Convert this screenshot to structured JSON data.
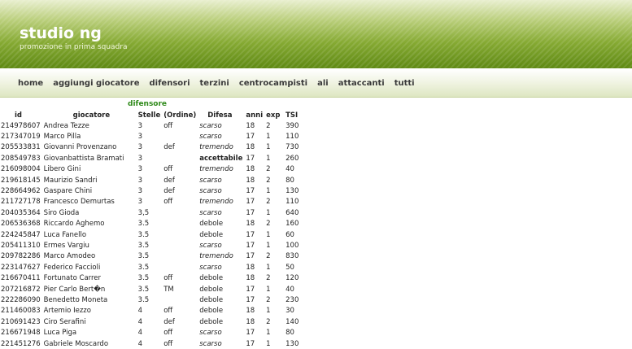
{
  "header": {
    "title": "studio ng",
    "subtitle": "promozione in prima squadra"
  },
  "nav": [
    "home",
    "aggiungi giocatore",
    "difensori",
    "terzini",
    "centrocampisti",
    "ali",
    "attaccanti",
    "tutti"
  ],
  "section_label": "difensore",
  "table": {
    "columns": [
      "id",
      "giocatore",
      "Stelle",
      "(Ordine)",
      "Difesa",
      "anni",
      "exp",
      "TSI"
    ],
    "rows": [
      [
        "214978607",
        "Andrea Tezze",
        "3",
        "off",
        "scarso",
        "18",
        "2",
        "390"
      ],
      [
        "217347019",
        "Marco Pilla",
        "3",
        "",
        "scarso",
        "17",
        "1",
        "110"
      ],
      [
        "205533831",
        "Giovanni Provenzano",
        "3",
        "def",
        "tremendo",
        "18",
        "1",
        "730"
      ],
      [
        "208549783",
        "Giovanbattista Bramati",
        "3",
        "",
        "accettabile",
        "17",
        "1",
        "260"
      ],
      [
        "216098004",
        "Libero Gini",
        "3",
        "off",
        "tremendo",
        "18",
        "2",
        "40"
      ],
      [
        "219618145",
        "Maurizio Sandri",
        "3",
        "def",
        "scarso",
        "18",
        "2",
        "80"
      ],
      [
        "228664962",
        "Gaspare Chini",
        "3",
        "def",
        "scarso",
        "17",
        "1",
        "130"
      ],
      [
        "211727178",
        "Francesco Demurtas",
        "3",
        "off",
        "tremendo",
        "17",
        "2",
        "110"
      ],
      [
        "204035364",
        "Siro Gioda",
        "3,5",
        "",
        "scarso",
        "17",
        "1",
        "640"
      ],
      [
        "206536368",
        "Riccardo Aghemo",
        "3.5",
        "",
        "debole",
        "18",
        "2",
        "160"
      ],
      [
        "224245847",
        "Luca Fanello",
        "3.5",
        "",
        "debole",
        "17",
        "1",
        "60"
      ],
      [
        "205411310",
        "Ermes Vargiu",
        "3.5",
        "",
        "scarso",
        "17",
        "1",
        "100"
      ],
      [
        "209782286",
        "Marco Amodeo",
        "3.5",
        "",
        "tremendo",
        "17",
        "2",
        "830"
      ],
      [
        "223147627",
        "Federico Faccioli",
        "3.5",
        "",
        "scarso",
        "18",
        "1",
        "50"
      ],
      [
        "216670411",
        "Fortunato Carrer",
        "3.5",
        "off",
        "debole",
        "18",
        "2",
        "120"
      ],
      [
        "207216872",
        "Pier Carlo Bert�n",
        "3.5",
        "TM",
        "debole",
        "17",
        "1",
        "40"
      ],
      [
        "222286090",
        "Benedetto Moneta",
        "3.5",
        "",
        "debole",
        "17",
        "2",
        "230"
      ],
      [
        "211460083",
        "Artemio Iezzo",
        "4",
        "off",
        "debole",
        "18",
        "1",
        "30"
      ],
      [
        "210691423",
        "Ciro Serafini",
        "4",
        "def",
        "debole",
        "18",
        "2",
        "140"
      ],
      [
        "216671948",
        "Luca Piga",
        "4",
        "off",
        "scarso",
        "17",
        "1",
        "80"
      ],
      [
        "221451276",
        "Gabriele Moscardo",
        "4",
        "off",
        "scarso",
        "17",
        "1",
        "130"
      ]
    ]
  }
}
